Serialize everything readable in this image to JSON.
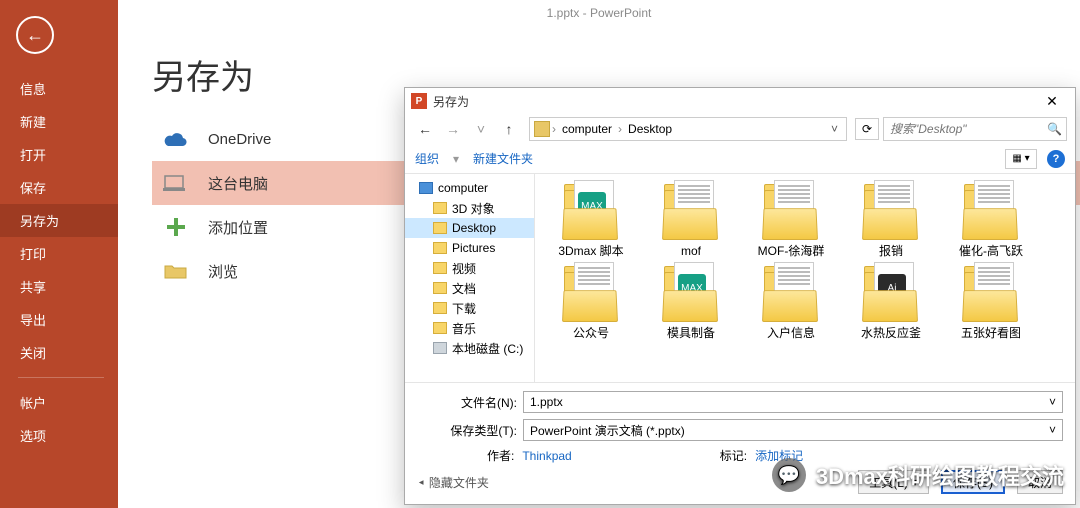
{
  "app": {
    "windowTitle": "1.pptx - PowerPoint"
  },
  "sidebar": {
    "items": [
      "信息",
      "新建",
      "打开",
      "保存",
      "另存为",
      "打印",
      "共享",
      "导出",
      "关闭"
    ],
    "accountItems": [
      "帐户",
      "选项"
    ],
    "activeIndex": 4
  },
  "page": {
    "title": "另存为"
  },
  "saveOptions": {
    "items": [
      {
        "label": "OneDrive"
      },
      {
        "label": "这台电脑"
      },
      {
        "label": "添加位置"
      },
      {
        "label": "浏览"
      }
    ],
    "selectedIndex": 1
  },
  "dialog": {
    "title": "另存为",
    "breadcrumb": {
      "root": "computer",
      "leaf": "Desktop"
    },
    "searchPlaceholder": "搜索\"Desktop\"",
    "toolbar": {
      "organize": "组织",
      "newFolder": "新建文件夹"
    },
    "tree": [
      {
        "label": "computer",
        "icon": "comp",
        "lvl": 1
      },
      {
        "label": "3D 对象",
        "icon": "folder",
        "lvl": 2
      },
      {
        "label": "Desktop",
        "icon": "folder",
        "lvl": 2,
        "selected": true
      },
      {
        "label": "Pictures",
        "icon": "folder",
        "lvl": 2
      },
      {
        "label": "视频",
        "icon": "folder",
        "lvl": 2
      },
      {
        "label": "文档",
        "icon": "folder",
        "lvl": 2
      },
      {
        "label": "下载",
        "icon": "folder",
        "lvl": 2
      },
      {
        "label": "音乐",
        "icon": "folder",
        "lvl": 2
      },
      {
        "label": "本地磁盘 (C:)",
        "icon": "drive",
        "lvl": 2
      }
    ],
    "files": [
      {
        "label": "3Dmax 脚本",
        "badge": "teal"
      },
      {
        "label": "mof",
        "badge": "bars"
      },
      {
        "label": "MOF-徐海群",
        "badge": "bars"
      },
      {
        "label": "报销",
        "badge": "bars"
      },
      {
        "label": "催化-高飞跃",
        "badge": "bars"
      },
      {
        "label": "公众号",
        "badge": "bars"
      },
      {
        "label": "模具制备",
        "badge": "teal"
      },
      {
        "label": "入户信息",
        "badge": "bars"
      },
      {
        "label": "水热反应釜",
        "badge": "black"
      },
      {
        "label": "五张好看图",
        "badge": "bars"
      }
    ],
    "filenameLabel": "文件名(N):",
    "filenameValue": "1.pptx",
    "filetypeLabel": "保存类型(T):",
    "filetypeValue": "PowerPoint 演示文稿 (*.pptx)",
    "authorLabel": "作者:",
    "authorValue": "Thinkpad",
    "tagLabel": "标记:",
    "tagPlaceholder": "添加标记",
    "hideFolders": "隐藏文件夹",
    "toolsBtn": "工具(L)",
    "saveBtn": "保存(S)",
    "cancelBtn": "取消"
  },
  "watermark": {
    "text": "3Dmax科研绘图教程交流"
  }
}
